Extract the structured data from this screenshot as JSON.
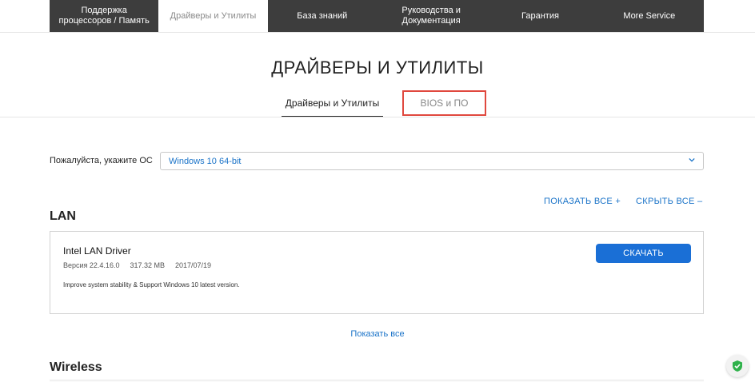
{
  "nav": {
    "items": [
      {
        "label": "Поддержка процессоров / Память"
      },
      {
        "label": "Драйверы и Утилиты",
        "active": true
      },
      {
        "label": "База знаний"
      },
      {
        "label": "Руководства и Документация"
      },
      {
        "label": "Гарантия"
      },
      {
        "label": "More Service"
      }
    ]
  },
  "page": {
    "title": "ДРАЙВЕРЫ И УТИЛИТЫ"
  },
  "subtabs": {
    "drivers": "Драйверы и Утилиты",
    "bios": "BIOS и ПО"
  },
  "os": {
    "label": "Пожалуйста, укажите ОС",
    "selected": "Windows 10 64-bit"
  },
  "controls": {
    "show_all": "ПОКАЗАТЬ ВСЕ +",
    "hide_all": "СКРЫТЬ ВСЕ –"
  },
  "sections": {
    "lan": {
      "title": "LAN",
      "driver": {
        "name": "Intel LAN Driver",
        "version": "Версия 22.4.16.0",
        "size": "317.32 MB",
        "date": "2017/07/19",
        "description": "Improve system stability & Support Windows 10 latest version.",
        "download_label": "СКАЧАТЬ"
      },
      "show_all": "Показать все"
    },
    "wireless": {
      "title": "Wireless"
    }
  },
  "colors": {
    "nav_bg": "#3d3d3d",
    "accent": "#1a73c8",
    "button": "#1a6fd6",
    "highlight_box": "#e0483e",
    "shield": "#2fb24b"
  },
  "icons": {
    "select_chevron": "chevron-down-icon",
    "security": "shield-check-icon"
  }
}
